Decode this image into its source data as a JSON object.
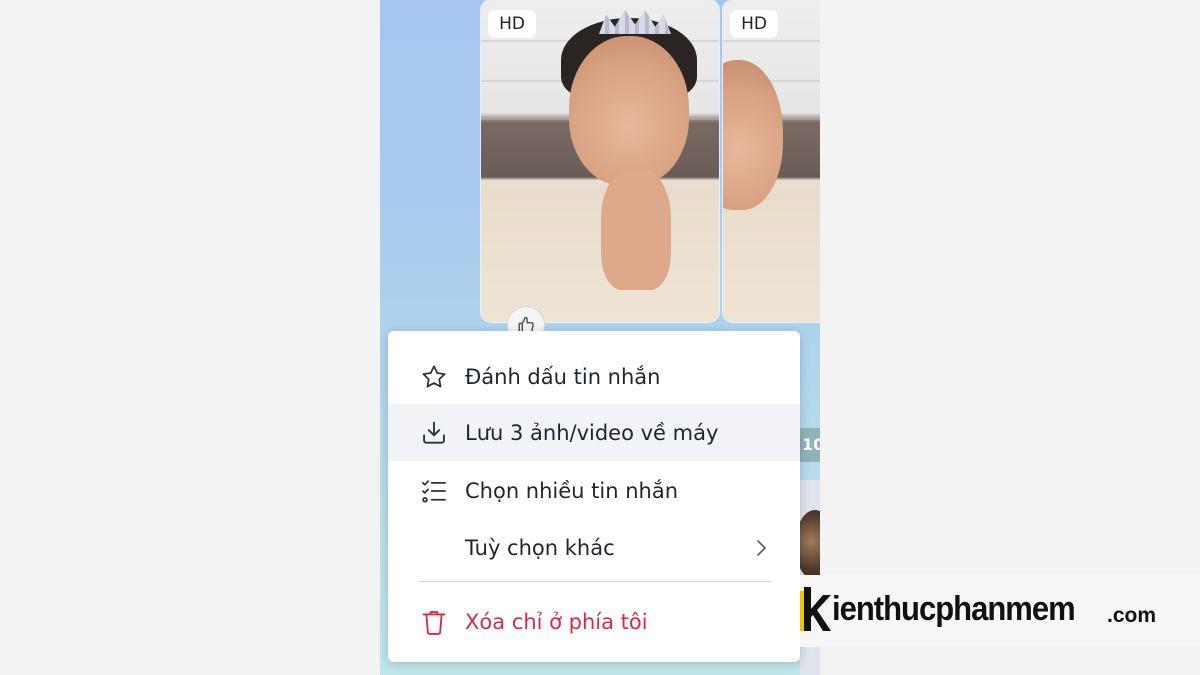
{
  "photos": [
    {
      "badge": "HD"
    },
    {
      "badge": "HD"
    }
  ],
  "side": {
    "time_fragment": "10"
  },
  "reaction_icon": "thumbs-up-icon",
  "menu": {
    "items": [
      {
        "icon": "star-icon",
        "label": "Đánh dấu tin nhắn"
      },
      {
        "icon": "download-icon",
        "label": "Lưu 3 ảnh/video về máy"
      },
      {
        "icon": "checklist-icon",
        "label": "Chọn nhiều tin nhắn"
      },
      {
        "icon": "",
        "label": "Tuỳ chọn khác"
      },
      {
        "icon": "trash-icon",
        "label": "Xóa chỉ ở phía tôi"
      }
    ],
    "danger_color": "#db2a42",
    "hover_color": "#f1f3f6"
  },
  "watermark": {
    "brand": "kienthucphanmem",
    "logo_letter": "k",
    "tld": ".com",
    "accent": "#f2c200"
  }
}
